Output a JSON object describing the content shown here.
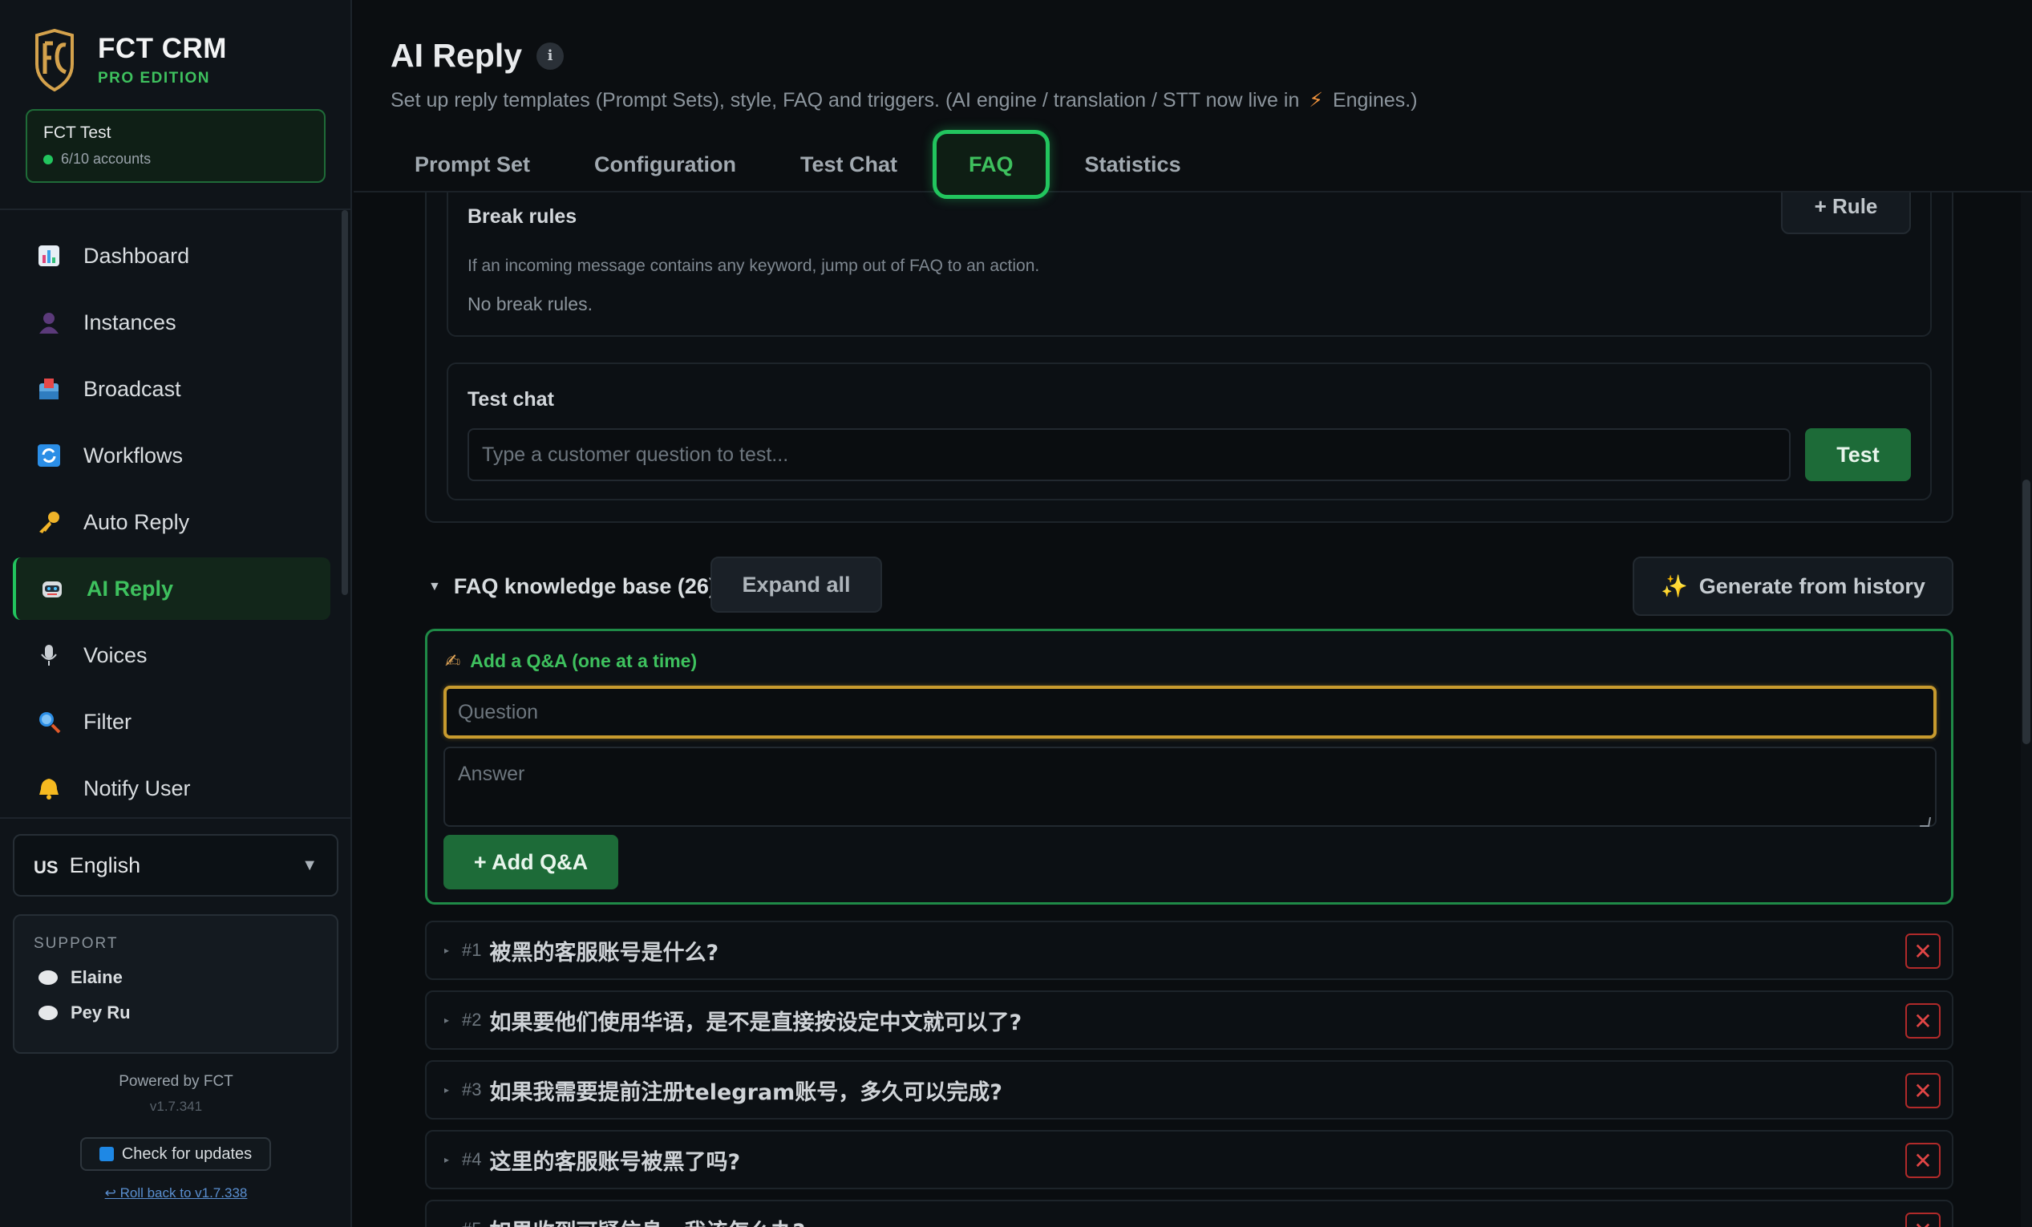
{
  "app": {
    "brand_title": "FCT CRM",
    "brand_sub": "PRO EDITION",
    "workspace_name": "FCT Test",
    "workspace_accounts": "6/10 accounts"
  },
  "sidebar": {
    "items": [
      {
        "label": "Dashboard",
        "icon": "bar-chart-icon"
      },
      {
        "label": "Instances",
        "icon": "user-icon"
      },
      {
        "label": "Broadcast",
        "icon": "inbox-icon"
      },
      {
        "label": "Workflows",
        "icon": "refresh-icon"
      },
      {
        "label": "Auto Reply",
        "icon": "key-icon"
      },
      {
        "label": "AI Reply",
        "icon": "robot-icon",
        "active": true
      },
      {
        "label": "Voices",
        "icon": "microphone-icon"
      },
      {
        "label": "Filter",
        "icon": "magnifier-icon"
      },
      {
        "label": "Notify User",
        "icon": "bell-icon"
      }
    ],
    "language_flag": "US",
    "language": "English",
    "support_label": "SUPPORT",
    "support_contacts": [
      "Elaine",
      "Pey Ru"
    ],
    "powered_by": "Powered by FCT",
    "version": "v1.7.341",
    "check_updates": "Check for updates",
    "rollback": "↩ Roll back to v1.7.338"
  },
  "header": {
    "title": "AI Reply",
    "info_icon": "i",
    "subtitle_pre": "Set up reply templates (Prompt Sets), style, FAQ and triggers. (AI engine / translation / STT now live in",
    "subtitle_post": "Engines.)",
    "tabs": [
      "Prompt Set",
      "Configuration",
      "Test Chat",
      "FAQ",
      "Statistics"
    ],
    "active_tab": "FAQ"
  },
  "break_rules": {
    "title": "Break rules",
    "add_button": "+ Rule",
    "description": "If an incoming message contains any keyword, jump out of FAQ to an action.",
    "empty": "No break rules."
  },
  "test_chat": {
    "title": "Test chat",
    "placeholder": "Type a customer question to test...",
    "button": "Test"
  },
  "kb": {
    "title": "FAQ knowledge base (26)",
    "expand_all": "Expand all",
    "generate": "Generate from history"
  },
  "add_qa": {
    "title": "Add a Q&A (one at a time)",
    "question_placeholder": "Question",
    "answer_placeholder": "Answer",
    "button": "+ Add Q&A"
  },
  "faq_items": [
    {
      "num": "#1",
      "question": "被黑的客服账号是什么?"
    },
    {
      "num": "#2",
      "question": "如果要他们使用华语，是不是直接按设定中文就可以了?"
    },
    {
      "num": "#3",
      "question": "如果我需要提前注册telegram账号，多久可以完成?"
    },
    {
      "num": "#4",
      "question": "这里的客服账号被黑了吗?"
    },
    {
      "num": "#5",
      "question": "如果收到可疑信息，我该怎么办?"
    }
  ],
  "colors": {
    "accent": "#22c55e",
    "focus": "#c79a2e",
    "danger": "#e04545"
  }
}
